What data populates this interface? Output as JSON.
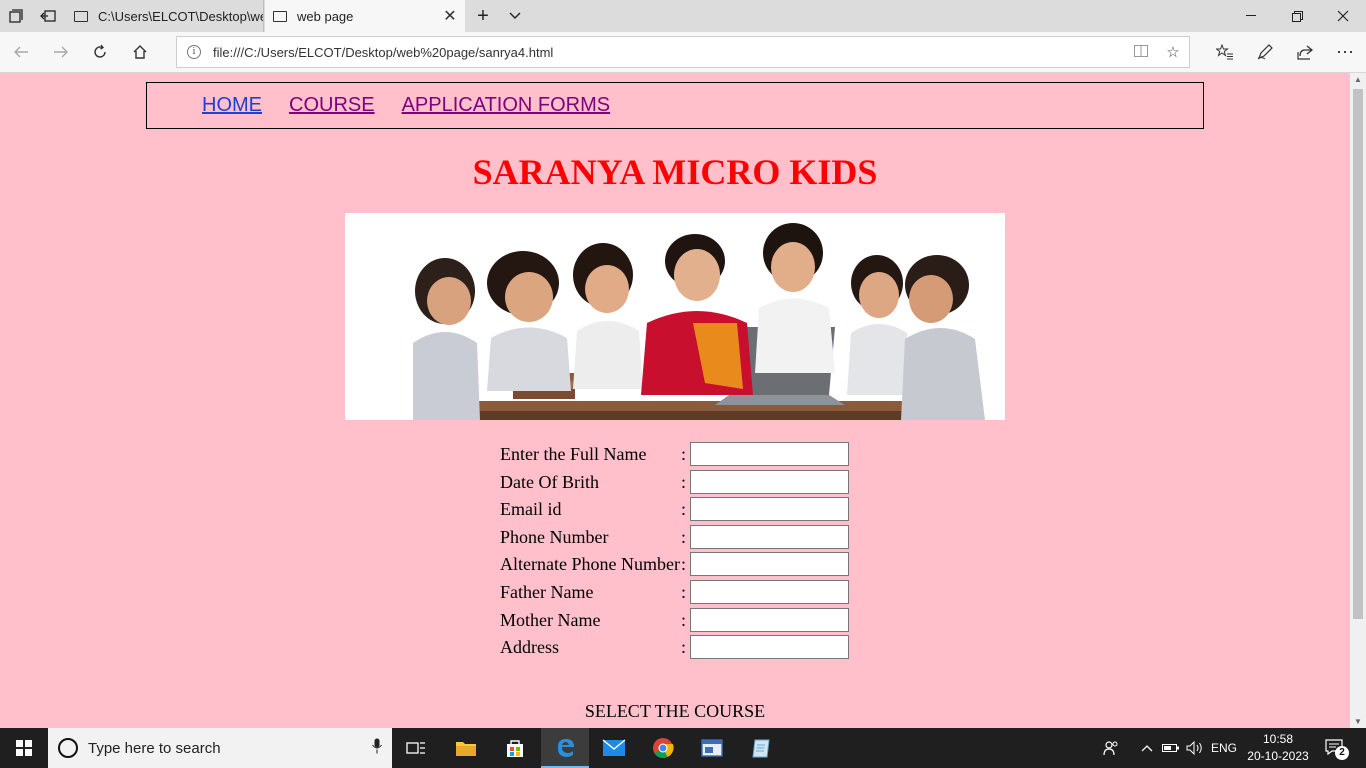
{
  "browser": {
    "tabs": [
      {
        "label": "C:\\Users\\ELCOT\\Desktop\\we",
        "active": false
      },
      {
        "label": "web page",
        "active": true
      }
    ],
    "address": "file:///C:/Users/ELCOT/Desktop/web%20page/sanrya4.html"
  },
  "page": {
    "nav": [
      "HOME",
      "COURSE",
      "APPLICATION FORMS"
    ],
    "title": "SARANYA MICRO KIDS",
    "form_fields": [
      {
        "label": "Enter the Full Name",
        "colon": ":",
        "value": ""
      },
      {
        "label": "Date Of Brith",
        "colon": ":",
        "value": ""
      },
      {
        "label": "Email id",
        "colon": ":",
        "value": ""
      },
      {
        "label": "Phone Number",
        "colon": ":",
        "value": ""
      },
      {
        "label": "Alternate Phone Number",
        "colon": ":",
        "value": ""
      },
      {
        "label": "Father Name",
        "colon": ":",
        "value": ""
      },
      {
        "label": "Mother Name",
        "colon": ":",
        "value": ""
      },
      {
        "label": "Address",
        "colon": ":",
        "value": ""
      }
    ],
    "select_heading": "SELECT THE COURSE"
  },
  "taskbar": {
    "search_placeholder": "Type here to search",
    "language": "ENG",
    "time": "10:58",
    "date": "20-10-2023",
    "notification_count": "2",
    "apps": [
      "task-view",
      "file-explorer",
      "store",
      "edge",
      "mail",
      "chrome",
      "app-window",
      "notepad"
    ]
  },
  "colors": {
    "page_background": "#ffc0cb",
    "title": "#ff0000",
    "link": "#2040d0",
    "visited_link": "#800080"
  }
}
